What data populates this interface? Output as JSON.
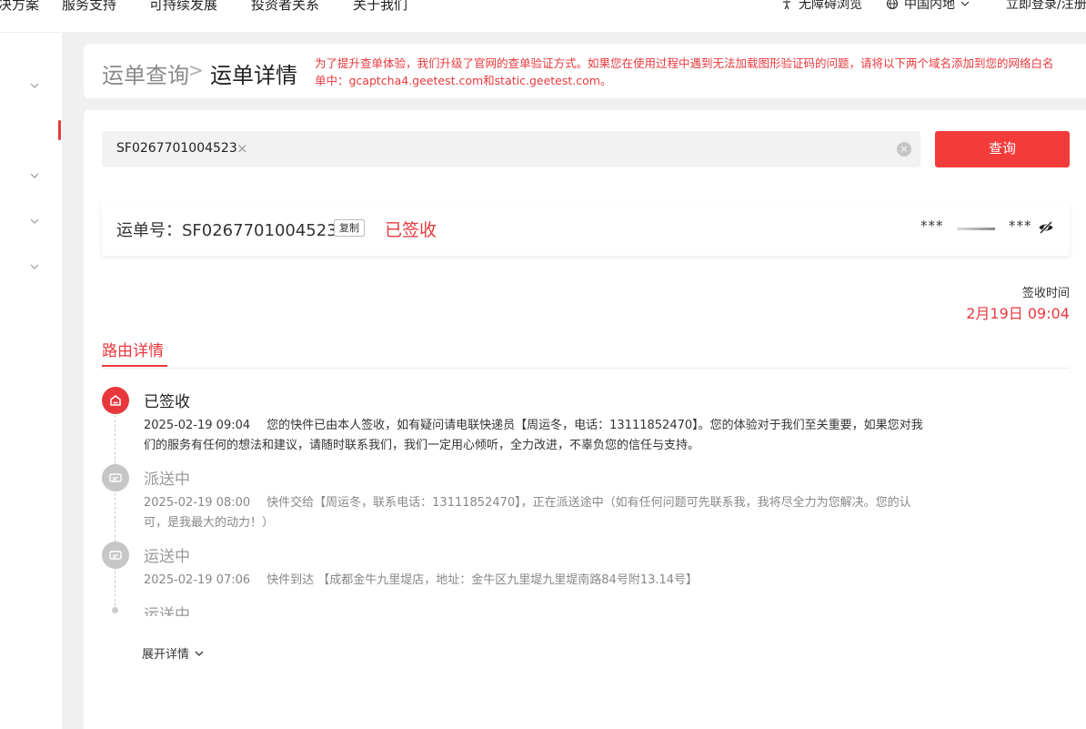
{
  "topnav": {
    "items": [
      "决方案",
      "服务支持",
      "可持续发展",
      "投资者关系",
      "关于我们"
    ],
    "accessibility": "无障碍浏览",
    "region": "中国内地",
    "login": "立即登录/注册"
  },
  "breadcrumb": {
    "prev": "运单查询",
    "sep": ">",
    "current": "运单详情",
    "notice": "为了提升查单体验，我们升级了官网的查单验证方式。如果您在使用过程中遇到无法加载图形验证码的问题，请将以下两个域名添加到您的网络白名单中：gcaptcha4.geetest.com和static.geetest.com。"
  },
  "search": {
    "tag": "SF0267701004523",
    "tag_close": "×",
    "clear": "×",
    "button": "查询"
  },
  "waybill": {
    "label": "运单号：SF0267701004523",
    "copy": "复制",
    "status": "已签收",
    "from": "***",
    "to": "***"
  },
  "sign": {
    "label": "签收时间",
    "time": "2月19日 09:04"
  },
  "tab": {
    "title": "路由详情"
  },
  "timeline": [
    {
      "status": "已签收",
      "time": "2025-02-19 09:04",
      "text": "您的快件已由本人签收，如有疑问请电联快递员【周运冬，电话：13111852470】。您的体验对于我们至关重要，如果您对我们的服务有任何的想法和建议，请随时联系我们，我们一定用心倾听，全力改进，不辜负您的信任与支持。"
    },
    {
      "status": "派送中",
      "time": "2025-02-19 08:00",
      "text": "快件交给【周运冬，联系电话：13111852470】，正在派送途中（如有任何问题可先联系我，我将尽全力为您解决。您的认可，是我最大的动力！）"
    },
    {
      "status": "运送中",
      "time": "2025-02-19 07:06",
      "text": "快件到达 【成都金牛九里堤店，地址：金牛区九里堤九里堤南路84号附13.14号】"
    },
    {
      "status": "运送中"
    }
  ],
  "expand": "展开详情",
  "colors": {
    "accent": "#e8383d",
    "button": "#f23b3b"
  }
}
